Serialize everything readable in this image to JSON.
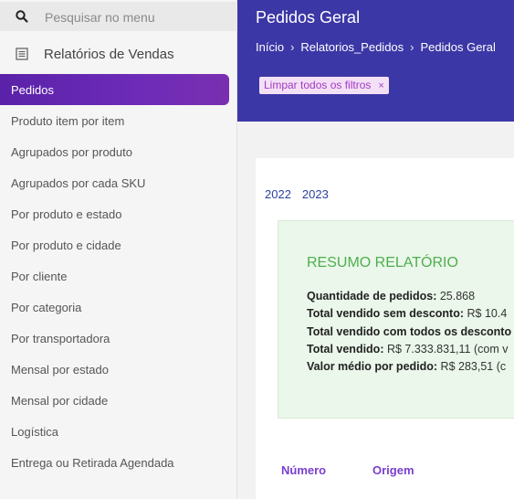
{
  "sidebar": {
    "search_placeholder": "Pesquisar no menu",
    "section_title": "Relatórios de Vendas",
    "active_item": "Pedidos",
    "items": [
      "Produto item por item",
      "Agrupados por produto",
      "Agrupados por cada SKU",
      "Por produto e estado",
      "Por produto e cidade",
      "Por cliente",
      "Por categoria",
      "Por transportadora",
      "Mensal por estado",
      "Mensal por cidade",
      "Logística",
      "Entrega ou Retirada Agendada"
    ]
  },
  "header": {
    "title": "Pedidos Geral",
    "breadcrumb": [
      "Início",
      "Relatorios_Pedidos",
      "Pedidos Geral"
    ],
    "filter_chip": "Limpar todos os filtros",
    "filter_chip_close": "×"
  },
  "main": {
    "years": [
      "2022",
      "2023"
    ],
    "summary": {
      "title": "RESUMO RELATÓRIO",
      "lines": [
        {
          "label": "Quantidade de pedidos:",
          "value": " 25.868"
        },
        {
          "label": "Total vendido sem desconto:",
          "value": " R$ 10.4"
        },
        {
          "label": "Total vendido com todos os desconto",
          "value": ""
        },
        {
          "label": "Total vendido:",
          "value": " R$ 7.333.831,11 (com v"
        },
        {
          "label": "Valor médio por pedido:",
          "value": " R$ 283,51 (c"
        }
      ]
    },
    "table_headers": [
      "Número",
      "Origem"
    ]
  },
  "colors": {
    "header_bg": "#3c37a6",
    "active_gradient_start": "#5a22a8",
    "summary_bg": "#eaf7ea",
    "summary_title": "#4fae4f",
    "table_header": "#7a3ed0"
  }
}
